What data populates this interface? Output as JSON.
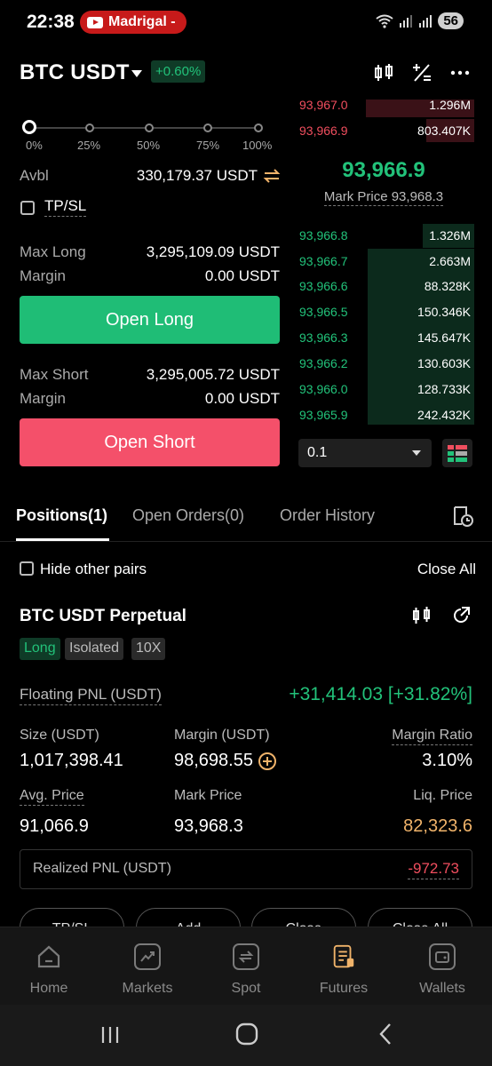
{
  "status_bar": {
    "time": "22:38",
    "notification_app": "Madrigal -",
    "battery": "56"
  },
  "header": {
    "pair": "BTC USDT",
    "change": "+0.60%"
  },
  "order_form": {
    "slider_marks": [
      "0%",
      "25%",
      "50%",
      "75%",
      "100%"
    ],
    "slider_value_percent": 0,
    "avbl_label": "Avbl",
    "avbl_value": "330,179.37 USDT",
    "tpsl_label": "TP/SL",
    "max_long_label": "Max Long",
    "max_long_value": "3,295,109.09 USDT",
    "margin_label": "Margin",
    "margin_long_value": "0.00 USDT",
    "open_long_label": "Open Long",
    "max_short_label": "Max Short",
    "max_short_value": "3,295,005.72 USDT",
    "margin_short_value": "0.00 USDT",
    "open_short_label": "Open Short"
  },
  "order_book": {
    "asks": [
      {
        "price": "93,967.0",
        "size": "1.296M"
      },
      {
        "price": "93,966.9",
        "size": "803.407K"
      }
    ],
    "last_price": "93,966.9",
    "mark_price_label": "Mark Price 93,968.3",
    "bids": [
      {
        "price": "93,966.8",
        "size": "1.326M"
      },
      {
        "price": "93,966.7",
        "size": "2.663M"
      },
      {
        "price": "93,966.6",
        "size": "88.328K"
      },
      {
        "price": "93,966.5",
        "size": "150.346K"
      },
      {
        "price": "93,966.3",
        "size": "145.647K"
      },
      {
        "price": "93,966.2",
        "size": "130.603K"
      },
      {
        "price": "93,966.0",
        "size": "128.733K"
      },
      {
        "price": "93,965.9",
        "size": "242.432K"
      }
    ],
    "precision": "0.1"
  },
  "tabs": {
    "positions": "Positions(1)",
    "open_orders": "Open Orders(0)",
    "order_history": "Order History"
  },
  "positions": {
    "hide_other_pairs": "Hide other pairs",
    "close_all": "Close All",
    "title": "BTC USDT Perpetual",
    "chips": [
      "Long",
      "Isolated",
      "10X"
    ],
    "floating_pnl_label": "Floating PNL (USDT)",
    "floating_pnl_value": "+31,414.03 [+31.82%]",
    "size_label": "Size (USDT)",
    "size_value": "1,017,398.41",
    "margin_label": "Margin (USDT)",
    "margin_value": "98,698.55",
    "margin_ratio_label": "Margin Ratio",
    "margin_ratio_value": "3.10%",
    "avg_price_label": "Avg. Price",
    "avg_price_value": "91,066.9",
    "mark_price_label": "Mark Price",
    "mark_price_value": "93,968.3",
    "liq_price_label": "Liq. Price",
    "liq_price_value": "82,323.6",
    "realized_label": "Realized PNL (USDT)",
    "realized_value": "-972.73",
    "actions": [
      "TP/SL",
      "Add",
      "Close",
      "Close All"
    ]
  },
  "bottom_nav": [
    {
      "label": "Home",
      "icon": "home-icon"
    },
    {
      "label": "Markets",
      "icon": "markets-icon"
    },
    {
      "label": "Spot",
      "icon": "spot-icon"
    },
    {
      "label": "Futures",
      "icon": "futures-icon"
    },
    {
      "label": "Wallets",
      "icon": "wallet-icon"
    }
  ],
  "colors": {
    "green": "#22c27a",
    "red": "#f04e5e",
    "long_button": "#1fbd76",
    "short_button": "#f4506a"
  }
}
